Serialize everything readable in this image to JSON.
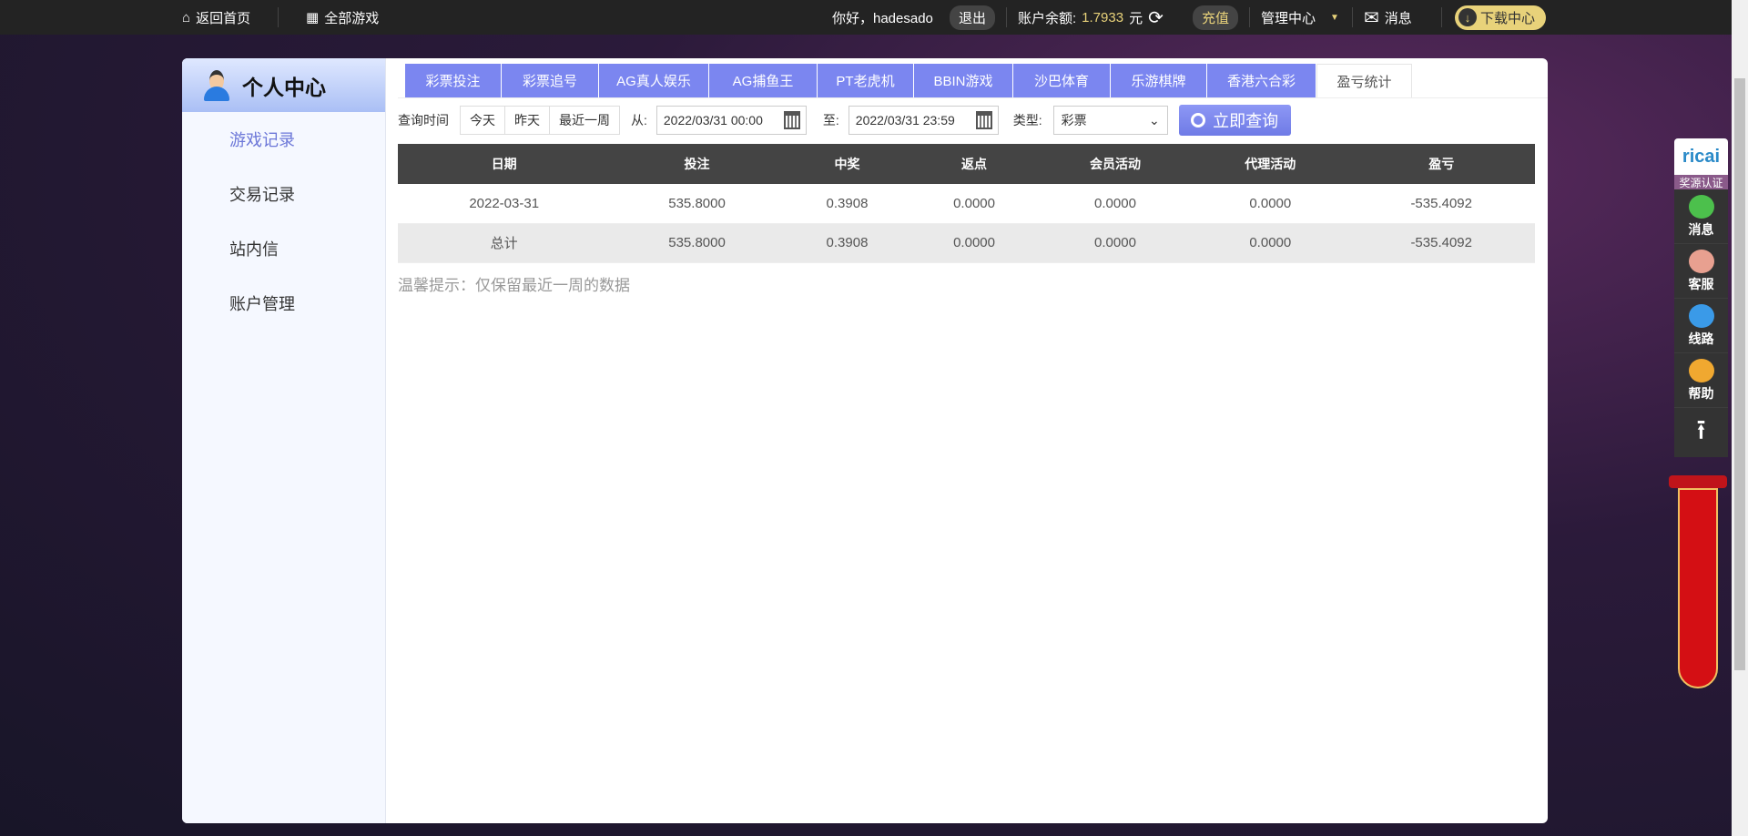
{
  "topbar": {
    "home": "返回首页",
    "all_games": "全部游戏",
    "greeting": "你好，hadesado",
    "logout": "退出",
    "balance_label": "账户余额:",
    "balance": "1.7933",
    "currency": "元",
    "recharge": "充值",
    "manage": "管理中心",
    "messages": "消息",
    "download": "下载中心"
  },
  "sidebar": {
    "title": "个人中心",
    "items": [
      {
        "label": "游戏记录"
      },
      {
        "label": "交易记录"
      },
      {
        "label": "站内信"
      },
      {
        "label": "账户管理"
      }
    ]
  },
  "tabs": [
    {
      "label": "彩票投注"
    },
    {
      "label": "彩票追号"
    },
    {
      "label": "AG真人娱乐"
    },
    {
      "label": "AG捕鱼王"
    },
    {
      "label": "PT老虎机"
    },
    {
      "label": "BBIN游戏"
    },
    {
      "label": "沙巴体育"
    },
    {
      "label": "乐游棋牌"
    },
    {
      "label": "香港六合彩"
    },
    {
      "label": "盈亏统计"
    }
  ],
  "query": {
    "time_label": "查询时间",
    "today": "今天",
    "yesterday": "昨天",
    "week": "最近一周",
    "from_label": "从:",
    "from": "2022/03/31 00:00",
    "to_label": "至:",
    "to": "2022/03/31 23:59",
    "type_label": "类型:",
    "type": "彩票",
    "search": "立即查询"
  },
  "table": {
    "headers": [
      "日期",
      "投注",
      "中奖",
      "返点",
      "会员活动",
      "代理活动",
      "盈亏"
    ],
    "rows": [
      [
        "2022-03-31",
        "535.8000",
        "0.3908",
        "0.0000",
        "0.0000",
        "0.0000",
        "-535.4092"
      ]
    ],
    "total": [
      "总计",
      "535.8000",
      "0.3908",
      "0.0000",
      "0.0000",
      "0.0000",
      "-535.4092"
    ]
  },
  "notice": "温馨提示：仅保留最近一周的数据",
  "float": {
    "logo": "ricai",
    "cert": "奖源认证",
    "items": [
      {
        "label": "消息",
        "color": "#4cc04c"
      },
      {
        "label": "客服",
        "color": "#e8a090"
      },
      {
        "label": "线路",
        "color": "#3a9ae8"
      },
      {
        "label": "帮助",
        "color": "#f0a830"
      }
    ],
    "top": "⭱"
  }
}
